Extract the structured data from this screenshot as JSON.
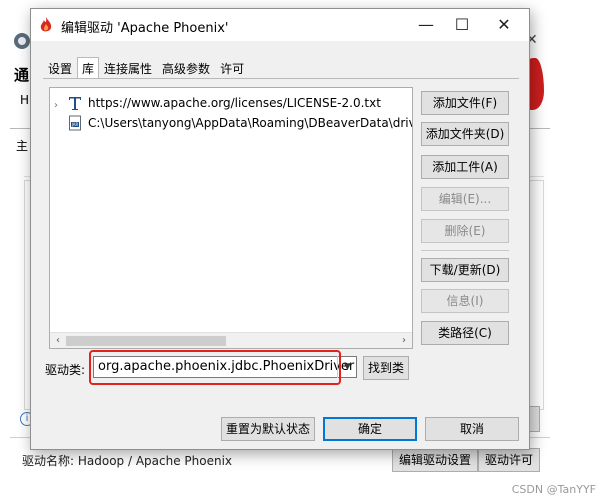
{
  "background_window": {
    "title_fragment": "通",
    "sub_fragment": "H",
    "main_tab_fragment": "主",
    "driver_name": "驱动名称: Hadoop / Apache Phoenix",
    "edit_driver_btn": "编辑驱动设置",
    "driver_license_btn": "驱动许可"
  },
  "dialog": {
    "title": "编辑驱动 'Apache Phoenix'",
    "tabs": [
      {
        "label": "设置"
      },
      {
        "label": "库"
      },
      {
        "label": "连接属性"
      },
      {
        "label": "高级参数"
      },
      {
        "label": "许可"
      }
    ],
    "libraries": [
      {
        "label": "https://www.apache.org/licenses/LICENSE-2.0.txt",
        "icon": "text-icon"
      },
      {
        "label": "C:\\Users\\tanyong\\AppData\\Roaming\\DBeaverData\\drivers",
        "icon": "jar-icon"
      }
    ],
    "buttons": {
      "add_file": "添加文件(F)",
      "add_folder": "添加文件夹(D)",
      "add_artifact": "添加工件(A)",
      "edit": "编辑(E)...",
      "delete": "删除(E)",
      "download_update": "下载/更新(D)",
      "info": "信息(I)",
      "classpath": "类路径(C)",
      "find_class": "找到类",
      "reset_default": "重置为默认状态",
      "ok": "确定",
      "cancel": "取消"
    },
    "driver_class_label": "驱动类:",
    "driver_class_value": "org.apache.phoenix.jdbc.PhoenixDriver"
  },
  "watermark": "CSDN @TanYYF",
  "colors": {
    "highlight": "#e2231a",
    "default_button_border": "#0078d7",
    "flame": "#cc1e1e"
  }
}
